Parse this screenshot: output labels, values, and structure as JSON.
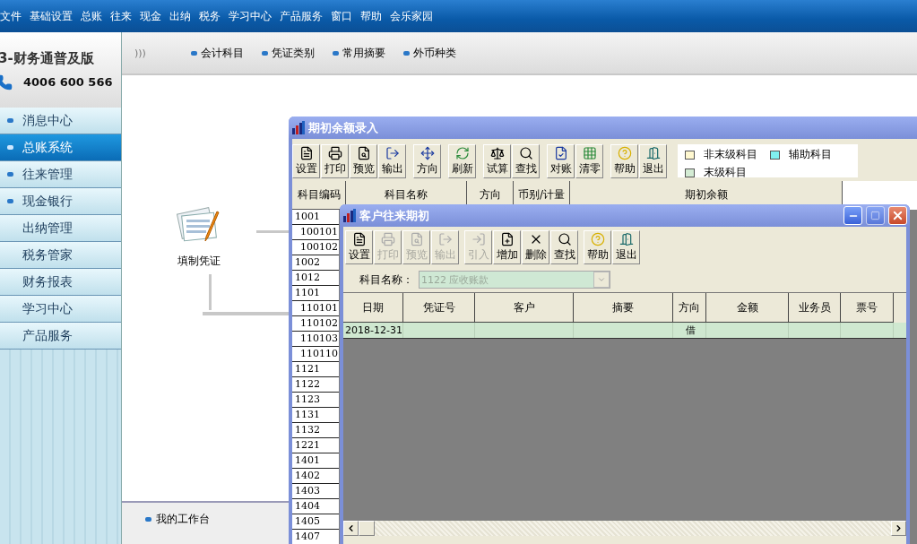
{
  "menu": [
    "文件",
    "基础设置",
    "总账",
    "往来",
    "现金",
    "出纳",
    "税务",
    "学习中心",
    "产品服务",
    "窗口",
    "帮助",
    "会乐家园"
  ],
  "brand": {
    "title": "3-财务通普及版",
    "phone": "4006 600 566"
  },
  "sidebar": {
    "items": [
      {
        "label": "消息中心",
        "kind": "group",
        "selected": false
      },
      {
        "label": "总账系统",
        "kind": "group",
        "selected": true
      },
      {
        "label": "往来管理",
        "kind": "group",
        "selected": false
      },
      {
        "label": "现金银行",
        "kind": "group",
        "selected": false
      },
      {
        "label": "出纳管理",
        "kind": "link",
        "selected": false
      },
      {
        "label": "税务管家",
        "kind": "link",
        "selected": false
      },
      {
        "label": "财务报表",
        "kind": "link",
        "selected": false
      },
      {
        "label": "学习中心",
        "kind": "link",
        "selected": false
      },
      {
        "label": "产品服务",
        "kind": "link",
        "selected": false
      }
    ]
  },
  "quick_bar": {
    "chevron": ")))",
    "items": [
      "会计科目",
      "凭证类别",
      "常用摘要",
      "外币种类"
    ]
  },
  "canvas": {
    "nodes": [
      {
        "label": "填制凭证"
      }
    ]
  },
  "workbench": {
    "items": [
      "我的工作台"
    ]
  },
  "balance_window": {
    "title": "期初余额录入",
    "toolbar": [
      [
        {
          "label": "设置",
          "disabled": false
        },
        {
          "label": "打印",
          "disabled": false
        },
        {
          "label": "预览",
          "disabled": false
        },
        {
          "label": "输出",
          "disabled": false
        }
      ],
      [
        {
          "label": "方向",
          "disabled": false
        }
      ],
      [
        {
          "label": "刷新",
          "disabled": false
        }
      ],
      [
        {
          "label": "试算",
          "disabled": false
        },
        {
          "label": "查找",
          "disabled": false
        }
      ],
      [
        {
          "label": "对账",
          "disabled": false
        },
        {
          "label": "清零",
          "disabled": false
        }
      ],
      [
        {
          "label": "帮助",
          "disabled": false
        },
        {
          "label": "退出",
          "disabled": false
        }
      ]
    ],
    "legend": [
      {
        "label": "非末级科目",
        "color": "#fff8d0"
      },
      {
        "label": "辅助科目",
        "color": "#80f0f0"
      },
      {
        "label": "末级科目",
        "color": "#d4ecd4"
      }
    ],
    "columns": [
      "科目编码",
      "科目名称",
      "方向",
      "币别/计量",
      "期初余额"
    ],
    "rows": [
      {
        "code": "1001",
        "children": [
          {
            "code": "100101"
          },
          {
            "code": "100102"
          }
        ]
      },
      {
        "code": "1002"
      },
      {
        "code": "1012"
      },
      {
        "code": "1101",
        "children": [
          {
            "code": "110101"
          },
          {
            "code": "110102"
          },
          {
            "code": "110103"
          },
          {
            "code": "110110"
          }
        ]
      },
      {
        "code": "1121"
      },
      {
        "code": "1122"
      },
      {
        "code": "1123"
      },
      {
        "code": "1131"
      },
      {
        "code": "1132"
      },
      {
        "code": "1221"
      },
      {
        "code": "1401"
      },
      {
        "code": "1402"
      },
      {
        "code": "1403"
      },
      {
        "code": "1404"
      },
      {
        "code": "1405"
      },
      {
        "code": "1407"
      }
    ]
  },
  "customer_window": {
    "title": "客户往来期初",
    "toolbar": [
      [
        {
          "label": "设置",
          "disabled": false
        },
        {
          "label": "打印",
          "disabled": true
        },
        {
          "label": "预览",
          "disabled": true
        },
        {
          "label": "输出",
          "disabled": true
        }
      ],
      [
        {
          "label": "引入",
          "disabled": true
        },
        {
          "label": "增加",
          "disabled": false
        },
        {
          "label": "删除",
          "disabled": false
        },
        {
          "label": "查找",
          "disabled": false
        }
      ],
      [
        {
          "label": "帮助",
          "disabled": false
        },
        {
          "label": "退出",
          "disabled": false
        }
      ]
    ],
    "subject": {
      "label": "科目名称：",
      "value": "1122 应收账款",
      "disabled": true
    },
    "columns": [
      "日期",
      "凭证号",
      "客户",
      "摘要",
      "方向",
      "金额",
      "业务员",
      "票号"
    ],
    "rows": [
      {
        "date": "2018-12-31",
        "direction": "借"
      }
    ]
  }
}
